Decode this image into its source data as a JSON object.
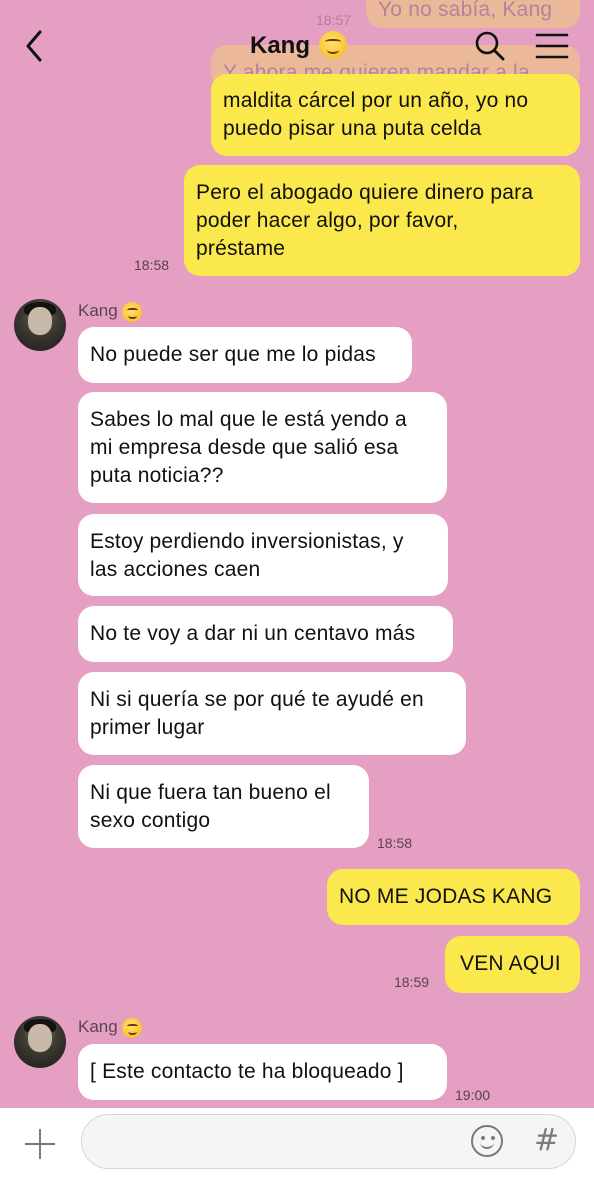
{
  "header": {
    "title": "Kang",
    "back_icon": "chevron-left-icon",
    "search_icon": "search-icon",
    "menu_icon": "hamburger-menu-icon"
  },
  "messages": {
    "faded_top_right": "Yo no sabía, Kang",
    "faded_time": "18:57",
    "faded_partial": "Y ahora me quieren mandar a la",
    "sent_1": "maldita cárcel por un año, yo no\npuedo pisar una puta celda",
    "sent_2": "Pero el abogado quiere dinero para\npoder hacer algo, por favor,\npréstame",
    "time_sent_2": "18:58",
    "sender_name_1": "Kang",
    "recv_1": "No puede ser que me lo pidas",
    "recv_2": "Sabes lo mal que le está yendo a\nmi empresa desde que salió esa\nputa noticia??",
    "recv_3": "Estoy perdiendo inversionistas, y\nlas acciones caen",
    "recv_4": "No te voy a dar ni un centavo más",
    "recv_5": "Ni si quería se por qué te ayudé en\nprimer lugar",
    "recv_6": "Ni que fuera tan bueno el\nsexo contigo",
    "time_recv_6": "18:58",
    "sent_3": "NO ME JODAS KANG",
    "sent_4": "VEN AQUI",
    "time_sent_4": "18:59",
    "sender_name_2": "Kang",
    "recv_7": "[ Este contacto te ha bloqueado ]",
    "time_recv_7": "19:00"
  },
  "input_bar": {
    "placeholder": "",
    "plus_icon": "plus-icon",
    "emoji_icon": "smiley-icon",
    "hashtag_icon": "hashtag-icon",
    "hash_glyph": "#"
  },
  "colors": {
    "background": "#e49fc3",
    "sent_bubble": "#fae84c",
    "received_bubble": "#ffffff"
  }
}
